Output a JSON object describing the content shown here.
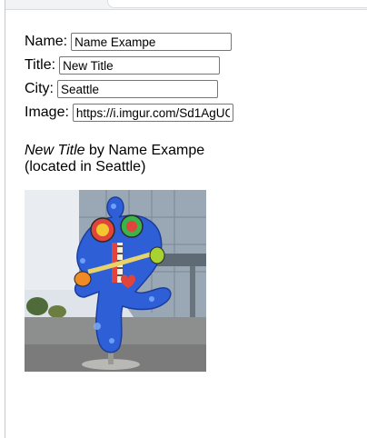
{
  "form": {
    "name_label": "Name:",
    "name_value": "Name Exampe",
    "title_label": "Title:",
    "title_value": "New Title",
    "city_label": "City:",
    "city_value": "Seattle",
    "image_label": "Image:",
    "image_value": "https://i.imgur.com/Sd1AgUC"
  },
  "caption": {
    "title": "New Title",
    "by_text": " by ",
    "name": "Name Exampe",
    "located_prefix": "(located in ",
    "city": "Seattle",
    "located_suffix": ")"
  },
  "colors": {
    "page_bg": "#ffffff",
    "input_border": "#767676"
  }
}
